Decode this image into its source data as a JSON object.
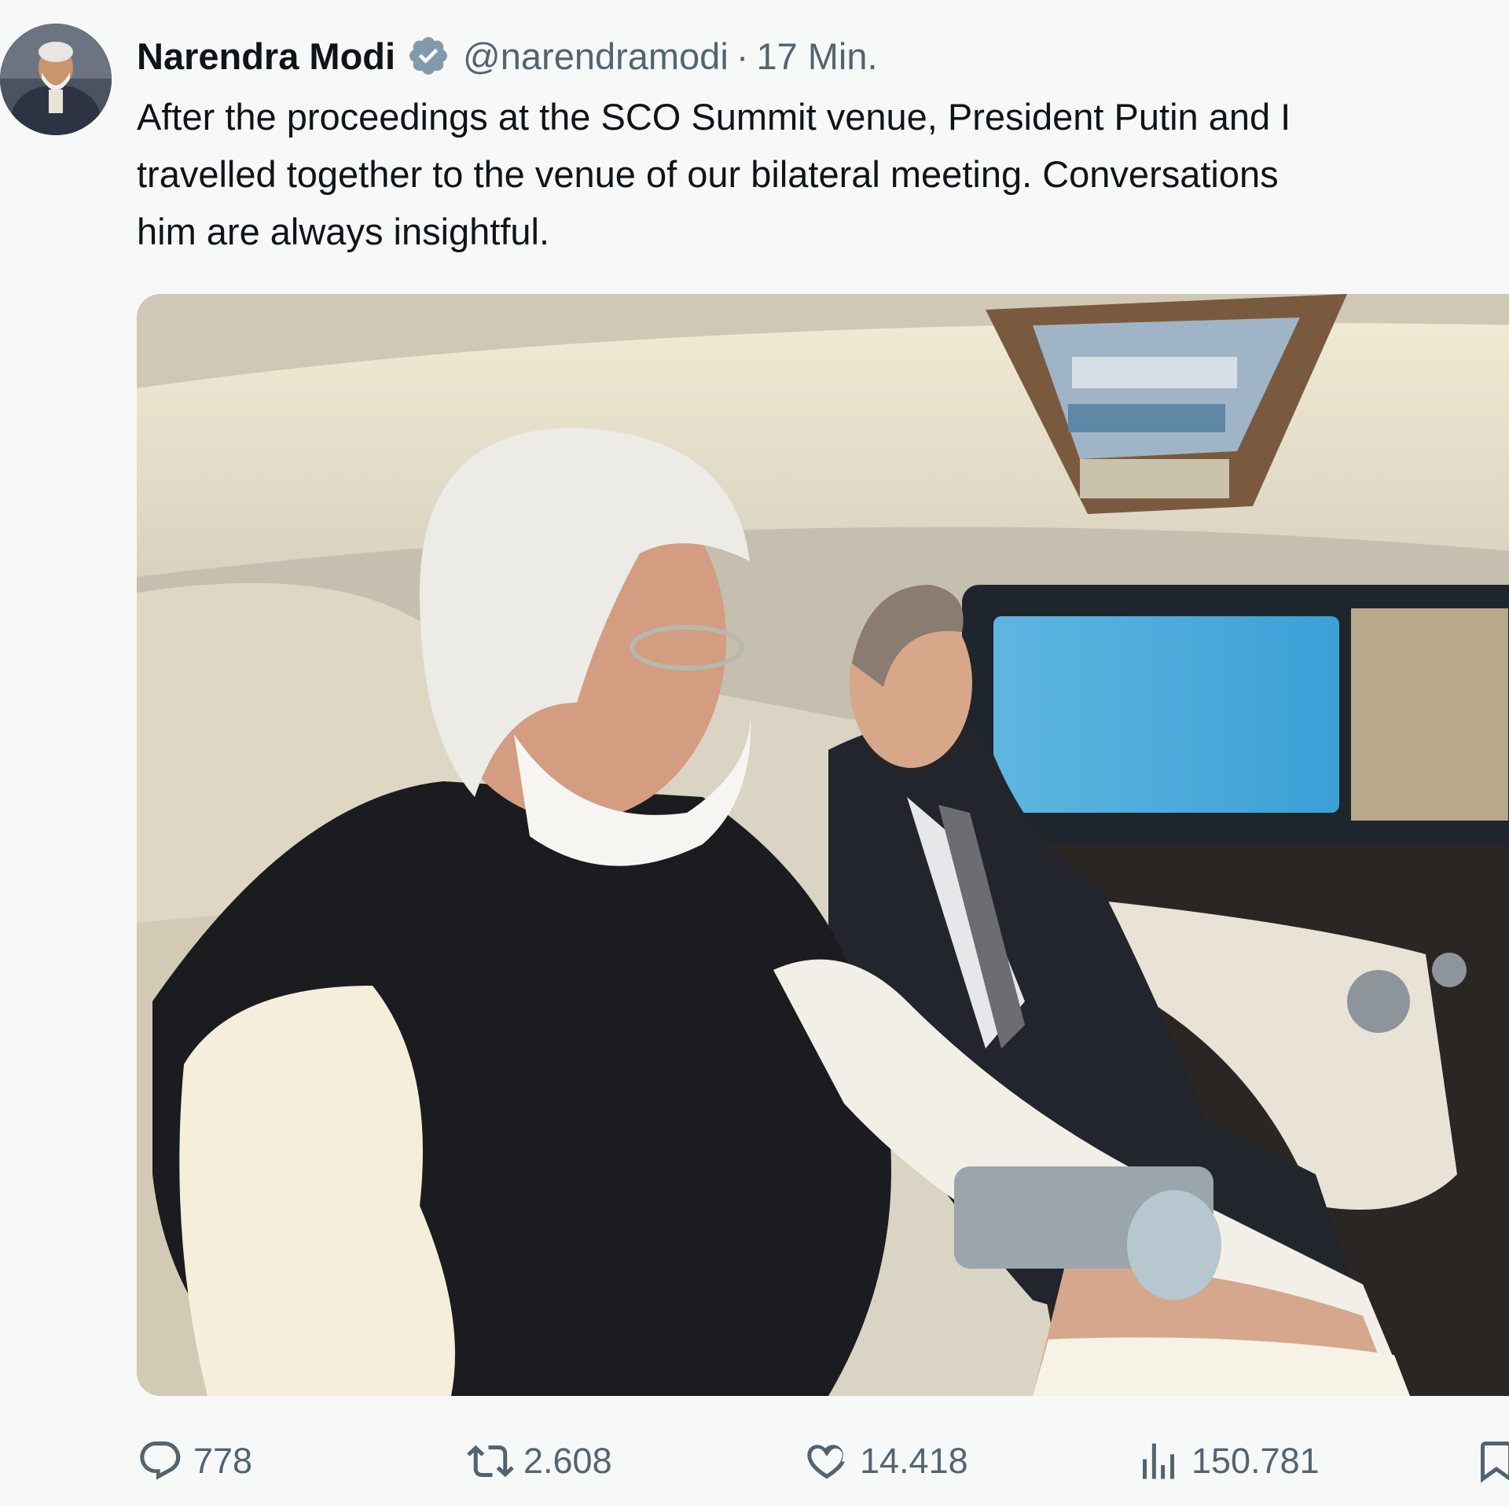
{
  "tweet": {
    "author_name": "Narendra Modi",
    "handle": "@narendramodi",
    "separator": "·",
    "time": "17 Min.",
    "text": "After the proceedings at the SCO Summit venue, President Putin and I\ntravelled together to the venue of our bilateral meeting. Conversations\nhim are always insightful.",
    "verified_icon": "verified-badge-icon",
    "colors": {
      "text": "#0f1419",
      "muted": "#536471",
      "verified": "#829aab",
      "background": "#f7f9f9"
    }
  },
  "actions": {
    "reply": {
      "icon": "reply-icon",
      "count": "778"
    },
    "retweet": {
      "icon": "retweet-icon",
      "count": "2.608"
    },
    "like": {
      "icon": "heart-icon",
      "count": "14.418"
    },
    "views": {
      "icon": "views-icon",
      "count": "150.781"
    },
    "bookmark": {
      "icon": "bookmark-icon"
    }
  }
}
